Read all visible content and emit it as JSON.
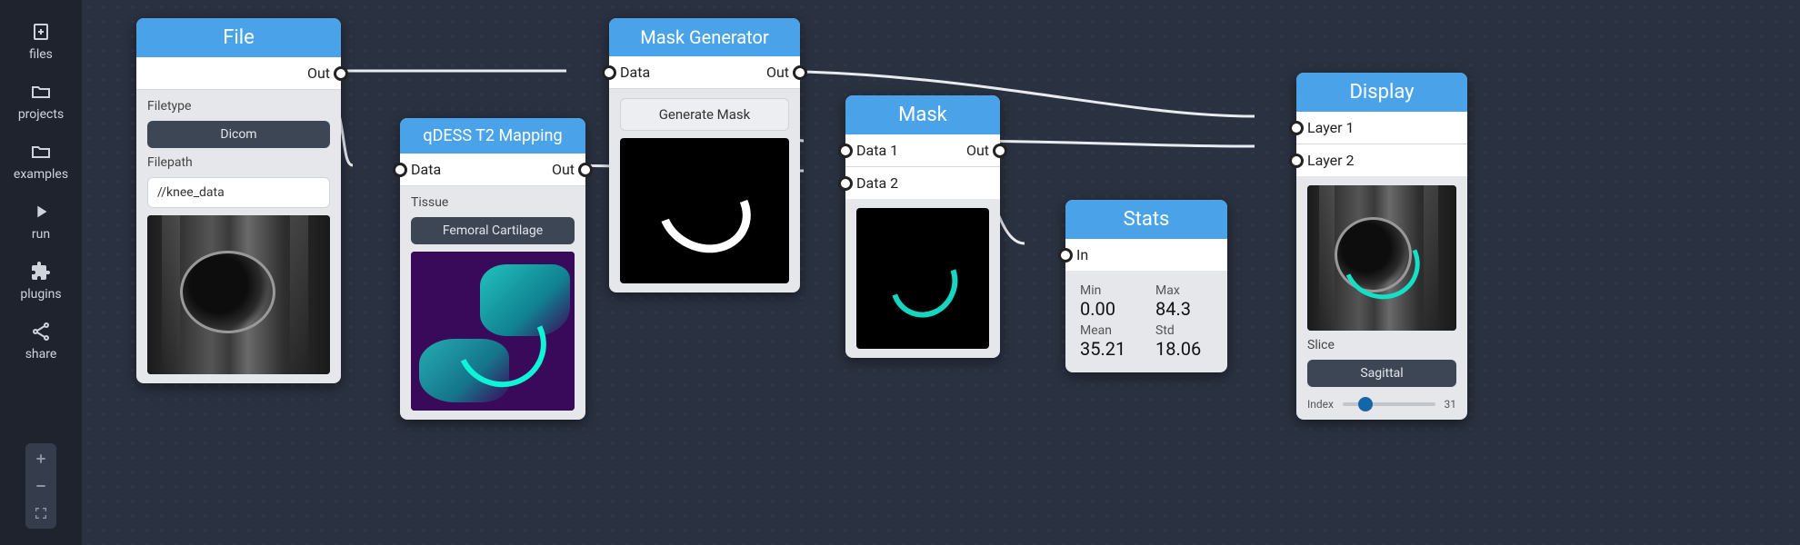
{
  "sidebar": {
    "items": [
      {
        "label": "files"
      },
      {
        "label": "projects"
      },
      {
        "label": "examples"
      },
      {
        "label": "run"
      },
      {
        "label": "plugins"
      },
      {
        "label": "share"
      }
    ]
  },
  "nodes": {
    "file": {
      "title": "File",
      "port_out": "Out",
      "filetype_label": "Filetype",
      "filetype_value": "Dicom",
      "filepath_label": "Filepath",
      "filepath_value": "//knee_data"
    },
    "qdess": {
      "title": "qDESS T2 Mapping",
      "port_in": "Data",
      "port_out": "Out",
      "tissue_label": "Tissue",
      "tissue_value": "Femoral Cartilage"
    },
    "maskgen": {
      "title": "Mask Generator",
      "port_in": "Data",
      "port_out": "Out",
      "generate_label": "Generate Mask"
    },
    "mask": {
      "title": "Mask",
      "port_in1": "Data 1",
      "port_in2": "Data 2",
      "port_out": "Out"
    },
    "stats": {
      "title": "Stats",
      "port_in": "In",
      "min_label": "Min",
      "min_value": "0.00",
      "max_label": "Max",
      "max_value": "84.3",
      "mean_label": "Mean",
      "mean_value": "35.21",
      "std_label": "Std",
      "std_value": "18.06"
    },
    "display": {
      "title": "Display",
      "layer1": "Layer 1",
      "layer2": "Layer 2",
      "slice_label": "Slice",
      "slice_value": "Sagittal",
      "index_label": "Index",
      "index_max": "31"
    }
  }
}
